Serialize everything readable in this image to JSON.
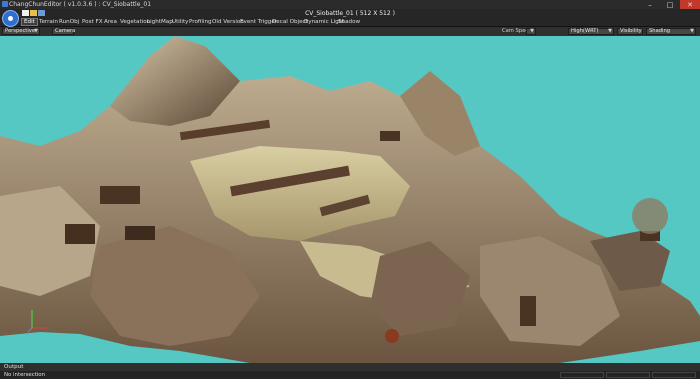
{
  "window": {
    "title": "ChangChunEditor ( v1.0.3.6 ) : CV_Siobattle_01",
    "controls": {
      "minimize": "–",
      "maximize": "□",
      "close": "✕"
    }
  },
  "menubar": {
    "document_title": "CV_Siobattle_01 ( 512 X 512 )",
    "tabs": [
      "Edit",
      "Terrain",
      "RunObj",
      "Post FX",
      "Area",
      "Vegetation",
      "LightMap",
      "Utility",
      "Profiling",
      "Old Version",
      "Event Trigger",
      "Decal Object",
      "Dynamic Light",
      "Shadow"
    ]
  },
  "options": {
    "view_mode": "Perspective",
    "camera_label": "Camera",
    "cam_speed_label": "Cam Speed",
    "quality": "High(WRT)",
    "visibility": "Visibility",
    "shading": "Shading"
  },
  "viewport": {
    "axis": {
      "x": "X",
      "y": "Y",
      "z": "Z"
    }
  },
  "output": {
    "title": "Output",
    "message": "No intersection"
  }
}
